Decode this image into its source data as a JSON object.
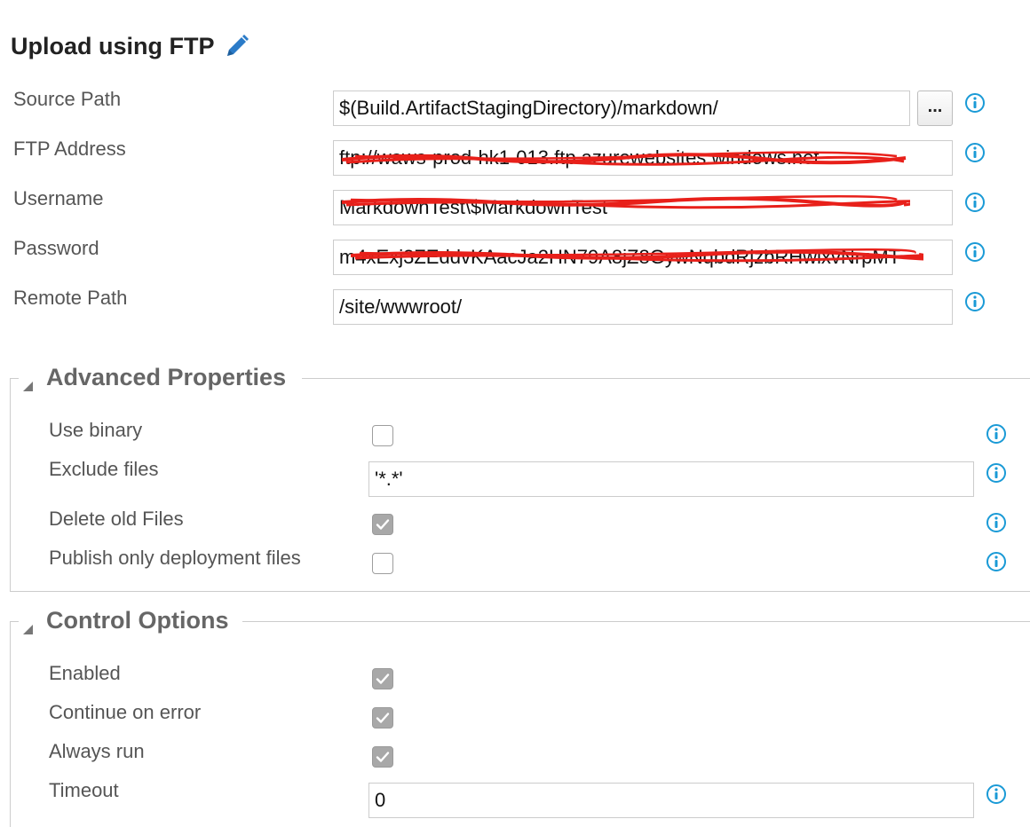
{
  "header": {
    "title": "Upload using FTP",
    "edit_icon": "pencil-icon"
  },
  "fields": {
    "source_path": {
      "label": "Source Path",
      "value": "$(Build.ArtifactStagingDirectory)/markdown/",
      "browse_label": "..."
    },
    "ftp_address": {
      "label": "FTP Address",
      "value": "ftp://waws-prod-hk1-013.ftp.azurewebsites.windows.net"
    },
    "username": {
      "label": "Username",
      "value": "MarkdownTest\\$MarkdownTest"
    },
    "password": {
      "label": "Password",
      "value": "m4xExj3ZEddvKAacJa2HN79A8jZ8GywNqbdRjzbRHwlxvNrpMT"
    },
    "remote_path": {
      "label": "Remote Path",
      "value": "/site/wwwroot/"
    }
  },
  "advanced": {
    "title": "Advanced Properties",
    "use_binary": {
      "label": "Use binary",
      "checked": false
    },
    "exclude_files": {
      "label": "Exclude files",
      "value": "'*.*'"
    },
    "delete_old_files": {
      "label": "Delete old Files",
      "checked": true
    },
    "publish_only_deployment": {
      "label": "Publish only deployment files",
      "checked": false
    }
  },
  "control": {
    "title": "Control Options",
    "enabled": {
      "label": "Enabled",
      "checked": true
    },
    "continue_on_error": {
      "label": "Continue on error",
      "checked": true
    },
    "always_run": {
      "label": "Always run",
      "checked": true
    },
    "timeout": {
      "label": "Timeout",
      "value": "0"
    }
  },
  "colors": {
    "info_icon": "#1a9ad6",
    "pencil_icon": "#2b7bc8",
    "redaction": "#e8201a",
    "checkbox_checked": "#a8a8a8"
  },
  "icons": {
    "info": "info-icon",
    "caret": "caret-down-icon",
    "check": "check-icon"
  }
}
